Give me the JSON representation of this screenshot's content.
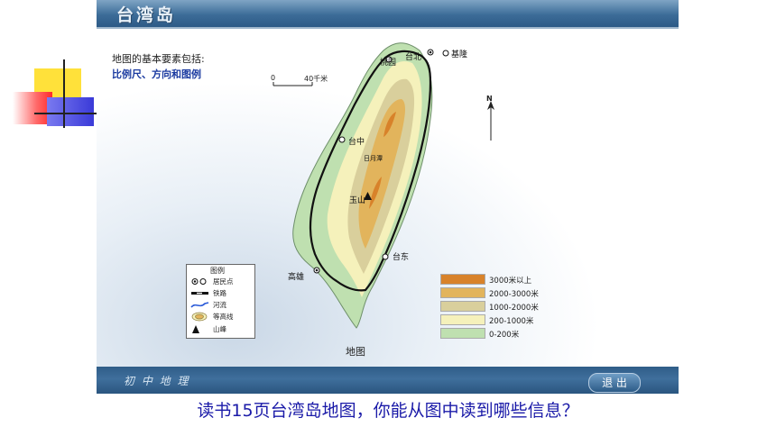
{
  "header": {
    "title": "台湾岛"
  },
  "footer": {
    "course_label": "初 中 地 理",
    "exit_label": "退 出"
  },
  "intro": {
    "heading": "地图的基本要素包括:",
    "elements": "比例尺、方向和图例"
  },
  "scale_bar": {
    "zero": "0",
    "distance": "40千米"
  },
  "north_label": "N",
  "map_caption": "地图",
  "places": {
    "taibei": "台北",
    "jilong": "基隆",
    "taoyuan": "桃园",
    "taizhong": "台中",
    "riyuetan": "日月潭",
    "yushan": "玉山",
    "taidong": "台东",
    "gaoxiong": "高雄"
  },
  "legend": {
    "title": "图例",
    "items": [
      {
        "label": "居民点",
        "icon": "settlement-icon"
      },
      {
        "label": "铁路",
        "icon": "railway-icon"
      },
      {
        "label": "河流",
        "icon": "river-icon"
      },
      {
        "label": "等高线",
        "icon": "contour-icon"
      },
      {
        "label": "山峰",
        "icon": "peak-icon"
      }
    ]
  },
  "elevation_key": [
    {
      "label": "3000米以上",
      "color": "#d8822a"
    },
    {
      "label": "2000-3000米",
      "color": "#e2b45c"
    },
    {
      "label": "1000-2000米",
      "color": "#d9cf9c"
    },
    {
      "label": "200-1000米",
      "color": "#f5f1bb"
    },
    {
      "label": "0-200米",
      "color": "#bfe0b0"
    }
  ],
  "question": "读书15页台湾岛地图，你能从图中读到哪些信息？",
  "colors": {
    "header_blue": "#3c6c98",
    "question_blue": "#1a1aa8",
    "deco_yellow": "#ffe13a",
    "deco_red": "#ff2a2a",
    "deco_blue": "#3a3ad8"
  }
}
